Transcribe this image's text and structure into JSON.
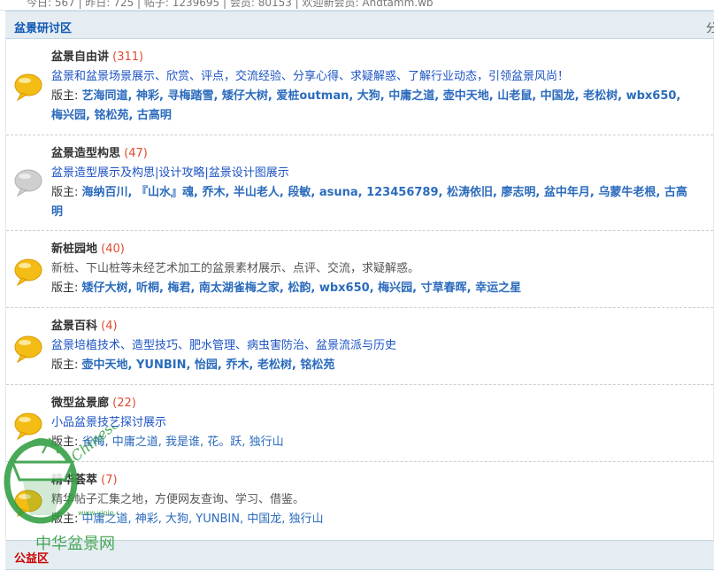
{
  "topbar": {
    "stats": "今日: 567 | 昨日: 725 | 帖子: 1239695 | 会员: 80153 | 欢迎新会员: Andtamm.wb"
  },
  "category": {
    "title": "盆景研讨区",
    "right_label": "分"
  },
  "forums": [
    {
      "name": "盆景自由讲",
      "count": "(311)",
      "desc": "盆景和盆景场景展示、欣赏、评点，交流经验、分享心得、求疑解惑、了解行业动态，引领盆景风尚！",
      "mods_label": "版主: ",
      "mods": "艺海同道, 神彩, 寻梅踏雪, 矮仔大树, 爱桩outman, 大狗, 中庸之道, 壶中天地, 山老鼠, 中国龙, 老松树, wbx650, 梅兴园, 铭松苑, 古高明",
      "icon": "new-posts-bubble-icon"
    },
    {
      "name": "盆景造型构思",
      "count": "(47)",
      "desc": "盆景造型展示及构思|设计攻略|盆景设计图展示",
      "mods_label": "版主: ",
      "mods": "海纳百川, 『山水』魂, 乔木, 半山老人, 段敏, asuna, 123456789, 松涛依旧, 廖志明, 盆中年月, 乌蒙牛老根, 古高明",
      "icon": "no-new-posts-bubble-icon"
    },
    {
      "name": "新桩园地",
      "count": "(40)",
      "desc": "新桩、下山桩等未经艺术加工的盆景素材展示、点评、交流，求疑解惑。",
      "mods_label": "版主: ",
      "mods": "矮仔大树, 听桐, 梅君, 南太湖雀梅之家, 松韵, wbx650, 梅兴园, 寸草春晖, 幸运之星",
      "icon": "new-posts-bubble-icon"
    },
    {
      "name": "盆景百科",
      "count": "(4)",
      "desc": "盆景培植技术、造型技巧、肥水管理、病虫害防治、盆景流派与历史",
      "mods_label": "版主: ",
      "mods": "壶中天地, YUNBIN, 怡园, 乔木, 老松树, 铭松苑",
      "icon": "new-posts-bubble-icon"
    },
    {
      "name": "微型盆景廊",
      "count": "(22)",
      "desc": "小品盆景技艺探讨展示",
      "mods_label": "版主: ",
      "mods": "雀梅, 中庸之道, 我是谁, 花。跃, 独行山",
      "icon": "new-posts-bubble-icon"
    },
    {
      "name": "精华荟萃",
      "count": "(7)",
      "desc": "精华帖子汇集之地，方便网友查询、学习、借鉴。",
      "mods_label": "版主: ",
      "mods": "中庸之道, 神彩, 大狗, YUNBIN, 中国龙, 独行山",
      "icon": "new-posts-bubble-icon"
    }
  ],
  "category2": {
    "title": "公益区"
  },
  "watermark": {
    "text_top": "Chinese",
    "text_url": "www.yipin.com",
    "text_bottom": "中华盆景网"
  },
  "colors": {
    "accent": "#0e57b3",
    "count": "#e04c2f",
    "header_bg": "#e5edf2",
    "category2_title": "#cc0000",
    "watermark": "#2a9b3a"
  }
}
